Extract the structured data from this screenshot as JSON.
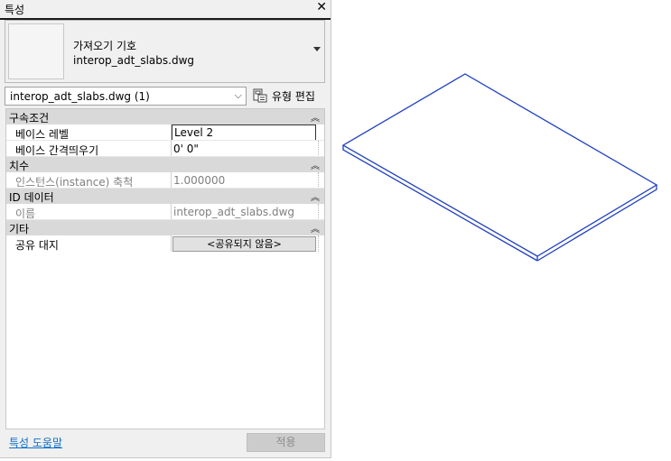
{
  "panel": {
    "title": "특성",
    "close_glyph": "✕"
  },
  "type_selector": {
    "family": "가져오기 기호",
    "type": "interop_adt_slabs.dwg"
  },
  "filter": {
    "value": "interop_adt_slabs.dwg (1)",
    "edit_type_label": "유형 편집"
  },
  "categories": [
    {
      "label": "구속조건",
      "props": [
        {
          "name": "베이스 레벨",
          "value": "Level 2"
        },
        {
          "name": "베이스 간격띄우기",
          "value": "0'  0\""
        }
      ]
    },
    {
      "label": "치수",
      "props": [
        {
          "name": "인스턴스(instance) 축척",
          "value": "1.000000"
        }
      ]
    },
    {
      "label": "ID 데이터",
      "props": [
        {
          "name": "이름",
          "value": "interop_adt_slabs.dwg"
        }
      ]
    },
    {
      "label": "기타",
      "props": [
        {
          "name": "공유 대지",
          "value": "<공유되지 않음>"
        }
      ]
    }
  ],
  "footer": {
    "help_link": "특성 도움말",
    "apply_label": "적용"
  },
  "view": {
    "slab_color": "#1f3fbf"
  }
}
